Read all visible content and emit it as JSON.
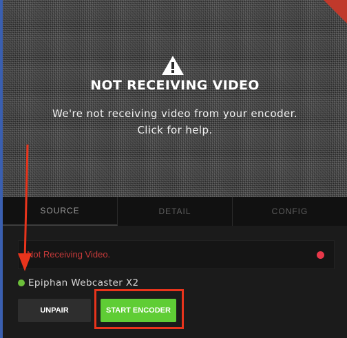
{
  "video": {
    "title": "NOT RECEIVING VIDEO",
    "message_line1": "We're not receiving video from your encoder.",
    "message_line2": "Click for help.",
    "icon": "warning-triangle-icon"
  },
  "tabs": [
    {
      "label": "SOURCE",
      "active": true
    },
    {
      "label": "DETAIL",
      "active": false
    },
    {
      "label": "CONFIG",
      "active": false
    }
  ],
  "source": {
    "status_text": "Not Receiving Video.",
    "status_color": "#e8384a",
    "device_name": "Epiphan Webcaster X2",
    "device_status_color": "#6cbf3a",
    "unpair_label": "UNPAIR",
    "start_label": "START ENCODER"
  },
  "colors": {
    "accent_green": "#5fcd35",
    "annotation_red": "#e8341c"
  }
}
